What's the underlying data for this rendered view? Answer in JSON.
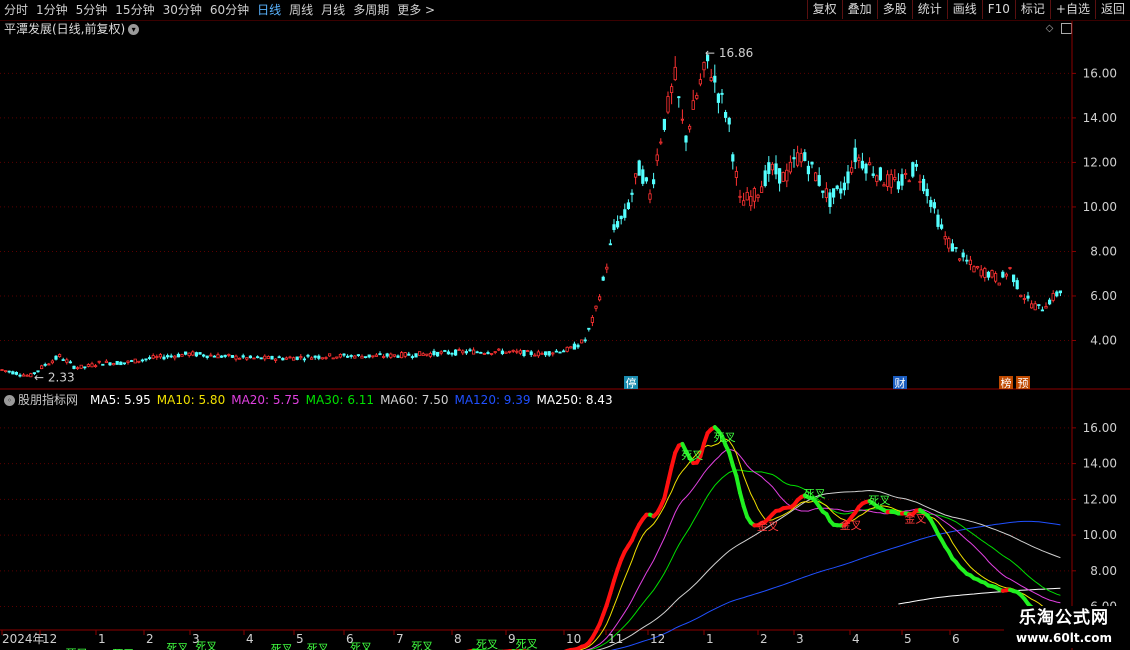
{
  "toolbar": {
    "periods": [
      "分时",
      "1分钟",
      "5分钟",
      "15分钟",
      "30分钟",
      "60分钟",
      "日线",
      "周线",
      "月线",
      "多周期",
      "更多"
    ],
    "active_index": 6,
    "more_arrow": ">",
    "buttons": [
      "复权",
      "叠加",
      "多股",
      "统计",
      "画线",
      "F10",
      "标记",
      "+自选",
      "返回"
    ]
  },
  "main_chart": {
    "title": "平潭发展(日线,前复权)",
    "title_icon": "chevron-down-icon",
    "corner_icons": [
      "diamond-icon",
      "layout-icon"
    ],
    "y_ticks": [
      "16.00",
      "14.00",
      "12.00",
      "10.00",
      "8.00",
      "6.00",
      "4.00"
    ],
    "high_label": "16.86",
    "low_label": "2.33",
    "event_markers": [
      "停",
      "财",
      "榜",
      "预"
    ]
  },
  "indicator": {
    "title": "股朋指标网",
    "title_icon": "circle-icon",
    "ma": [
      {
        "label": "MA5: 5.95",
        "color": "#ffffff"
      },
      {
        "label": "MA10: 5.80",
        "color": "#f0e000"
      },
      {
        "label": "MA20: 5.75",
        "color": "#e040e0"
      },
      {
        "label": "MA30: 6.11",
        "color": "#00e000"
      },
      {
        "label": "MA60: 7.50",
        "color": "#d0d0d0"
      },
      {
        "label": "MA120: 9.39",
        "color": "#2050ff"
      },
      {
        "label": "MA250: 8.43",
        "color": "#ffffff"
      }
    ],
    "y_ticks": [
      "16.00",
      "14.00",
      "12.00",
      "10.00",
      "8.00",
      "6.00"
    ],
    "death_cross": "死叉",
    "golden_cross": "金叉"
  },
  "date_axis": {
    "labels": [
      "2024年",
      "12",
      "1",
      "2",
      "3",
      "4",
      "5",
      "6",
      "7",
      "8",
      "9",
      "10",
      "11",
      "12",
      "1",
      "2",
      "3",
      "4",
      "5",
      "6"
    ]
  },
  "watermark": {
    "title": "乐淘公式网",
    "url": "www.60lt.com"
  },
  "colors": {
    "up": "#ff3232",
    "down": "#54ffff",
    "red_axis": "#8b0000",
    "ma5": "#ffffff",
    "ma10": "#f0e000",
    "ma20": "#e040e0",
    "ma30": "#00e000",
    "ma60": "#d0d0d0",
    "ma120": "#2050ff",
    "ma250": "#ffffff",
    "ribbon_up": "#ff1010",
    "ribbon_down": "#20f020"
  },
  "chart_data": {
    "type": "candlestick",
    "title": "平潭发展(日线,前复权)",
    "months": [
      "2023-11",
      "2023-12",
      "2024-01",
      "2024-02",
      "2024-03",
      "2024-04",
      "2024-05",
      "2024-06",
      "2024-07",
      "2024-08",
      "2024-09",
      "2024-10",
      "2024-11",
      "2024-12",
      "2025-01",
      "2025-02",
      "2025-03",
      "2025-04",
      "2025-05",
      "2025-06"
    ],
    "close_keypoints": [
      [
        0,
        2.7
      ],
      [
        20,
        2.5
      ],
      [
        30,
        2.4
      ],
      [
        45,
        2.9
      ],
      [
        60,
        3.3
      ],
      [
        75,
        2.8
      ],
      [
        85,
        2.8
      ],
      [
        100,
        3.0
      ],
      [
        125,
        3.0
      ],
      [
        150,
        3.2
      ],
      [
        190,
        3.4
      ],
      [
        220,
        3.3
      ],
      [
        250,
        3.2
      ],
      [
        280,
        3.2
      ],
      [
        330,
        3.3
      ],
      [
        380,
        3.3
      ],
      [
        430,
        3.4
      ],
      [
        470,
        3.5
      ],
      [
        500,
        3.5
      ],
      [
        540,
        3.4
      ],
      [
        570,
        3.6
      ],
      [
        585,
        4.0
      ],
      [
        595,
        5.2
      ],
      [
        605,
        7.0
      ],
      [
        615,
        9.2
      ],
      [
        625,
        9.6
      ],
      [
        640,
        11.8
      ],
      [
        650,
        10.5
      ],
      [
        660,
        13.0
      ],
      [
        675,
        15.8
      ],
      [
        685,
        13.0
      ],
      [
        700,
        15.5
      ],
      [
        708,
        16.5
      ],
      [
        718,
        15.2
      ],
      [
        728,
        14.0
      ],
      [
        740,
        10.2
      ],
      [
        755,
        10.5
      ],
      [
        770,
        11.7
      ],
      [
        785,
        11.3
      ],
      [
        800,
        12.4
      ],
      [
        815,
        11.5
      ],
      [
        830,
        10.3
      ],
      [
        845,
        11.0
      ],
      [
        855,
        12.3
      ],
      [
        870,
        11.8
      ],
      [
        885,
        11.2
      ],
      [
        900,
        11.0
      ],
      [
        915,
        11.8
      ],
      [
        925,
        11.0
      ],
      [
        935,
        9.8
      ],
      [
        945,
        8.6
      ],
      [
        960,
        7.8
      ],
      [
        975,
        7.2
      ],
      [
        990,
        7.0
      ],
      [
        1000,
        6.7
      ],
      [
        1010,
        7.2
      ],
      [
        1020,
        6.2
      ],
      [
        1030,
        5.7
      ],
      [
        1040,
        5.4
      ],
      [
        1050,
        5.8
      ],
      [
        1062,
        6.3
      ]
    ],
    "ylim_main": [
      2.0,
      17.5
    ],
    "ylim_indicator": [
      4.8,
      17.0
    ],
    "high": 16.86,
    "low": 2.33,
    "ma_last": {
      "MA5": 5.95,
      "MA10": 5.8,
      "MA20": 5.75,
      "MA30": 6.11,
      "MA60": 7.5,
      "MA120": 9.39,
      "MA250": 8.43
    }
  }
}
